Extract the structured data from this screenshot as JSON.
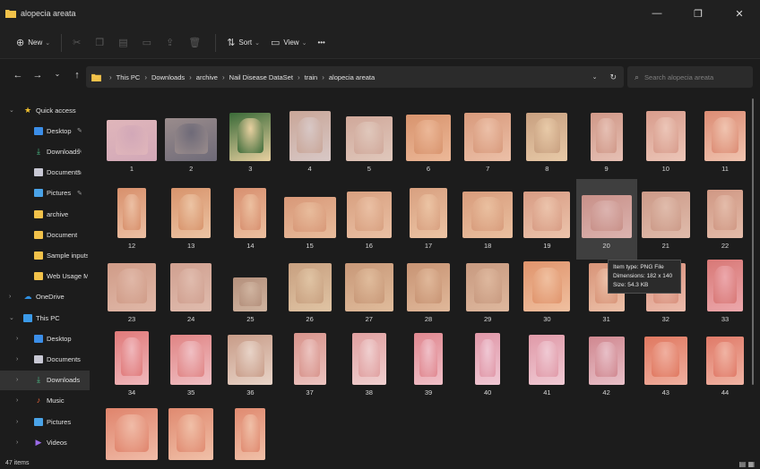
{
  "window": {
    "title": "alopecia areata",
    "minimize_glyph": "—",
    "maximize_glyph": "❐",
    "close_glyph": "✕"
  },
  "toolbar": {
    "new_label": "New",
    "sort_label": "Sort",
    "view_label": "View",
    "more_label": "•••"
  },
  "breadcrumb": [
    "This PC",
    "Downloads",
    "archive",
    "Nail Disease DataSet",
    "train",
    "alopecia areata"
  ],
  "search": {
    "placeholder": "Search alopecia areata"
  },
  "sidebar": {
    "items": [
      {
        "label": "Quick access",
        "icon": "star-icon",
        "color": "#f2c12e",
        "pinned": false,
        "level": 0,
        "chevron": "open"
      },
      {
        "label": "Desktop",
        "icon": "desktop-icon",
        "color": "#3b8ee8",
        "pinned": true,
        "level": 1,
        "chevron": "none"
      },
      {
        "label": "Downloads",
        "icon": "download-icon",
        "color": "#4cc08a",
        "pinned": true,
        "level": 1,
        "chevron": "none"
      },
      {
        "label": "Documents",
        "icon": "document-icon",
        "color": "#c8c8d4",
        "pinned": true,
        "level": 1,
        "chevron": "none"
      },
      {
        "label": "Pictures",
        "icon": "pictures-icon",
        "color": "#4aa3e8",
        "pinned": true,
        "level": 1,
        "chevron": "none"
      },
      {
        "label": "archive",
        "icon": "folder-icon",
        "color": "#f2c24a",
        "pinned": false,
        "level": 1,
        "chevron": "none"
      },
      {
        "label": "Document",
        "icon": "folder-icon",
        "color": "#f2c24a",
        "pinned": false,
        "level": 1,
        "chevron": "none"
      },
      {
        "label": "Sample inputs",
        "icon": "folder-icon",
        "color": "#f2c24a",
        "pinned": false,
        "level": 1,
        "chevron": "none"
      },
      {
        "label": "Web Usage Mir",
        "icon": "folder-icon",
        "color": "#f2c24a",
        "pinned": false,
        "level": 1,
        "chevron": "none"
      },
      {
        "label": "OneDrive",
        "icon": "cloud-icon",
        "color": "#2f8fe0",
        "pinned": false,
        "level": 0,
        "chevron": "closed"
      },
      {
        "label": "This PC",
        "icon": "computer-icon",
        "color": "#3b9ae8",
        "pinned": false,
        "level": 0,
        "chevron": "open"
      },
      {
        "label": "Desktop",
        "icon": "desktop-icon",
        "color": "#3b8ee8",
        "pinned": false,
        "level": 1,
        "chevron": "closed"
      },
      {
        "label": "Documents",
        "icon": "document-icon",
        "color": "#c8c8d4",
        "pinned": false,
        "level": 1,
        "chevron": "closed"
      },
      {
        "label": "Downloads",
        "icon": "download-icon",
        "color": "#4cc08a",
        "pinned": false,
        "level": 1,
        "chevron": "closed",
        "selected": true
      },
      {
        "label": "Music",
        "icon": "music-icon",
        "color": "#e8643a",
        "pinned": false,
        "level": 1,
        "chevron": "closed"
      },
      {
        "label": "Pictures",
        "icon": "pictures-icon",
        "color": "#4aa3e8",
        "pinned": false,
        "level": 1,
        "chevron": "closed"
      },
      {
        "label": "Videos",
        "icon": "video-icon",
        "color": "#9b6ae8",
        "pinned": false,
        "level": 1,
        "chevron": "closed"
      }
    ]
  },
  "files": [
    {
      "name": "1",
      "w": 56,
      "h": 46,
      "base": "#e0b6ba",
      "bed": "#d2a8b8"
    },
    {
      "name": "2",
      "w": 58,
      "h": 48,
      "base": "#9a8c8c",
      "bed": "#6e6a78"
    },
    {
      "name": "3",
      "w": 46,
      "h": 54,
      "base": "#3a6a38",
      "bed": "#e8d0a0"
    },
    {
      "name": "4",
      "w": 46,
      "h": 56,
      "base": "#c9a698",
      "bed": "#d8c8c6"
    },
    {
      "name": "5",
      "w": 52,
      "h": 50,
      "base": "#d0a89a",
      "bed": "#e0c8bc"
    },
    {
      "name": "6",
      "w": 50,
      "h": 52,
      "base": "#d8946e",
      "bed": "#ecb898"
    },
    {
      "name": "7",
      "w": 52,
      "h": 54,
      "base": "#d89a7c",
      "bed": "#ecc0a8"
    },
    {
      "name": "8",
      "w": 46,
      "h": 54,
      "base": "#c8a080",
      "bed": "#e8caa8"
    },
    {
      "name": "9",
      "w": 36,
      "h": 54,
      "base": "#d09888",
      "bed": "#e6c0b4"
    },
    {
      "name": "10",
      "w": 44,
      "h": 56,
      "base": "#d89c8c",
      "bed": "#ecc6b8"
    },
    {
      "name": "11",
      "w": 46,
      "h": 56,
      "base": "#dc8c74",
      "bed": "#f0c4b0"
    },
    {
      "name": "12",
      "w": 32,
      "h": 56,
      "base": "#d8906c",
      "bed": "#ecc0a4"
    },
    {
      "name": "13",
      "w": 44,
      "h": 56,
      "base": "#d8946c",
      "bed": "#ecc4a4"
    },
    {
      "name": "14",
      "w": 36,
      "h": 56,
      "base": "#d89070",
      "bed": "#ecc0a0"
    },
    {
      "name": "15",
      "w": 58,
      "h": 46,
      "base": "#d89878",
      "bed": "#e8bc9c"
    },
    {
      "name": "16",
      "w": 50,
      "h": 52,
      "base": "#d8a080",
      "bed": "#eac0a4"
    },
    {
      "name": "17",
      "w": 42,
      "h": 56,
      "base": "#d8a080",
      "bed": "#ecc4a4"
    },
    {
      "name": "18",
      "w": 56,
      "h": 52,
      "base": "#d89c7c",
      "bed": "#eac0a0"
    },
    {
      "name": "19",
      "w": 52,
      "h": 52,
      "base": "#d89c84",
      "bed": "#ecc4ac"
    },
    {
      "name": "20",
      "w": 56,
      "h": 48,
      "base": "#c89088",
      "bed": "#dcb4b0",
      "selected": true
    },
    {
      "name": "21",
      "w": 54,
      "h": 52,
      "base": "#cc9a88",
      "bed": "#e0bcac"
    },
    {
      "name": "22",
      "w": 40,
      "h": 54,
      "base": "#d09884",
      "bed": "#e4bcaa"
    },
    {
      "name": "23",
      "w": 54,
      "h": 54,
      "base": "#d09c88",
      "bed": "#e0b8a8"
    },
    {
      "name": "24",
      "w": 46,
      "h": 54,
      "base": "#d0a090",
      "bed": "#e0bcae"
    },
    {
      "name": "25",
      "w": 38,
      "h": 38,
      "base": "#b4907c",
      "bed": "#d0b4a0"
    },
    {
      "name": "26",
      "w": 48,
      "h": 54,
      "base": "#c8a080",
      "bed": "#e0c4a4"
    },
    {
      "name": "27",
      "w": 54,
      "h": 54,
      "base": "#c89878",
      "bed": "#e0bc9c"
    },
    {
      "name": "28",
      "w": 48,
      "h": 54,
      "base": "#c89474",
      "bed": "#e0b89a"
    },
    {
      "name": "29",
      "w": 48,
      "h": 54,
      "base": "#c89a80",
      "bed": "#deb89e"
    },
    {
      "name": "30",
      "w": 52,
      "h": 56,
      "base": "#e0946c",
      "bed": "#f0c0a0"
    },
    {
      "name": "31",
      "w": 40,
      "h": 54,
      "base": "#d89478",
      "bed": "#ecc0a8"
    },
    {
      "name": "32",
      "w": 44,
      "h": 54,
      "base": "#d8907c",
      "bed": "#ecbcac"
    },
    {
      "name": "33",
      "w": 40,
      "h": 58,
      "base": "#d87876",
      "bed": "#eca8ac"
    },
    {
      "name": "34",
      "w": 38,
      "h": 60,
      "base": "#e07a7a",
      "bed": "#f0b8bc"
    },
    {
      "name": "35",
      "w": 46,
      "h": 56,
      "base": "#e08484",
      "bed": "#f0c0c4"
    },
    {
      "name": "36",
      "w": 50,
      "h": 56,
      "base": "#c89c88",
      "bed": "#e8d4c8"
    },
    {
      "name": "37",
      "w": 36,
      "h": 58,
      "base": "#d8948c",
      "bed": "#ecc4c0"
    },
    {
      "name": "38",
      "w": 38,
      "h": 58,
      "base": "#e0a0a0",
      "bed": "#f0d0d0"
    },
    {
      "name": "39",
      "w": 32,
      "h": 58,
      "base": "#e08890",
      "bed": "#f0c0c8"
    },
    {
      "name": "40",
      "w": 28,
      "h": 58,
      "base": "#e098a8",
      "bed": "#f0c8d4"
    },
    {
      "name": "41",
      "w": 40,
      "h": 56,
      "base": "#e09aa8",
      "bed": "#f0cad4"
    },
    {
      "name": "42",
      "w": 40,
      "h": 54,
      "base": "#d08890",
      "bed": "#e8c0c8"
    },
    {
      "name": "43",
      "w": 48,
      "h": 54,
      "base": "#e07860",
      "bed": "#f0b0a0"
    },
    {
      "name": "44",
      "w": 42,
      "h": 54,
      "base": "#e07a68",
      "bed": "#f0b4a4"
    },
    {
      "name": "",
      "w": 58,
      "h": 58,
      "base": "#e0846c",
      "bed": "#f0bca8"
    },
    {
      "name": "",
      "w": 50,
      "h": 58,
      "base": "#e08a70",
      "bed": "#f0c0a8"
    },
    {
      "name": "",
      "w": 34,
      "h": 58,
      "base": "#e08a70",
      "bed": "#f0c0a8"
    }
  ],
  "tooltip": {
    "line1": "Item type: PNG File",
    "line2": "Dimensions: 182 x 140",
    "line3": "Size: 54.3 KB"
  },
  "status": {
    "items_text": "47 items"
  },
  "colors": {
    "bg": "#1c1c1c",
    "folder": "#f2c24a",
    "accent": "#3b8ee8"
  }
}
